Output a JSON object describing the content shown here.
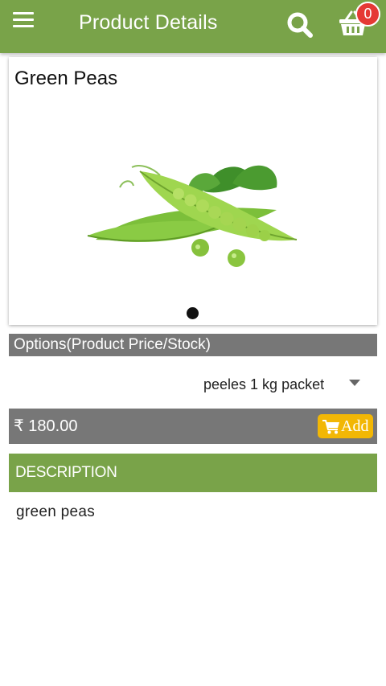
{
  "appbar": {
    "title": "Product Details",
    "cart_count": "0",
    "color": "#79a349"
  },
  "icons": {
    "menu": "menu-icon",
    "search": "search-icon",
    "cart": "shopping-basket-icon",
    "add": "cart-icon"
  },
  "product": {
    "name": "Green Peas",
    "image": "green-peas-pods-photo",
    "slider_total": 1,
    "slider_active": 1
  },
  "options": {
    "header": "Options(Product Price/Stock)",
    "selected": "peeles 1 kg packet"
  },
  "price": {
    "currency_symbol": "₹",
    "amount": "180.00",
    "add_label": "Add",
    "add_color": "#f2b705"
  },
  "description": {
    "header": "DESCRIPTION",
    "text": "green peas"
  }
}
